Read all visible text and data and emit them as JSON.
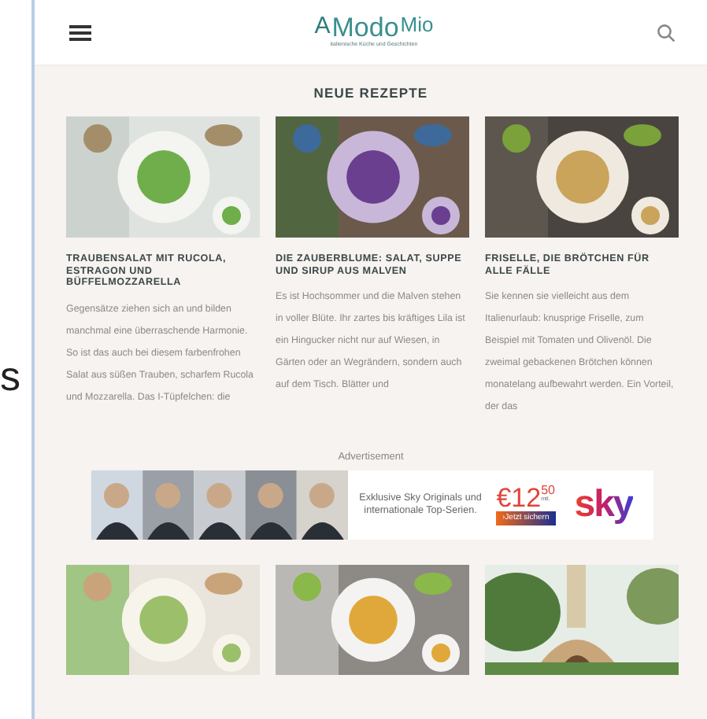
{
  "slide_text": "s",
  "header": {
    "logo": {
      "first": "A",
      "middle": "Modo",
      "last": "Mio",
      "tagline": "italienische Küche und Geschichten"
    }
  },
  "section_title": "NEUE REZEPTE",
  "recipes": [
    {
      "title": "TRAUBENSALAT MIT RUCOLA, ESTRAGON UND BÜFFELMOZZARELLA",
      "excerpt": "Gegensätze ziehen sich an und bilden manchmal eine überraschende Harmonie. So ist das auch bei diesem farbenfrohen Salat aus süßen Trauben, scharfem Rucola und Mozzarella. Das I-Tüpfelchen: die"
    },
    {
      "title": "DIE ZAUBERBLUME: SALAT, SUPPE UND SIRUP AUS MALVEN",
      "excerpt": "Es ist Hochsommer und die Malven stehen in voller Blüte. Ihr zartes bis kräftiges Lila ist ein Hingucker nicht nur auf Wiesen, in Gärten oder an Wegrändern, sondern auch auf dem Tisch. Blätter und"
    },
    {
      "title": "FRISELLE, DIE BRÖTCHEN FÜR ALLE FÄLLE",
      "excerpt": "Sie kennen sie vielleicht aus dem Italienurlaub: knusprige Friselle, zum Beispiel mit Tomaten und Olivenöl. Die zweimal gebackenen Brötchen können monatelang aufbewahrt werden. Ein Vorteil, der das"
    }
  ],
  "advertisement": {
    "label": "Advertisement",
    "tagline": "Exklusive Sky Originals und internationale Top-Serien.",
    "price": "€12",
    "price_cents": "50",
    "price_unit": "mtl.",
    "button": "›Jetzt sichern",
    "brand": "sky"
  }
}
